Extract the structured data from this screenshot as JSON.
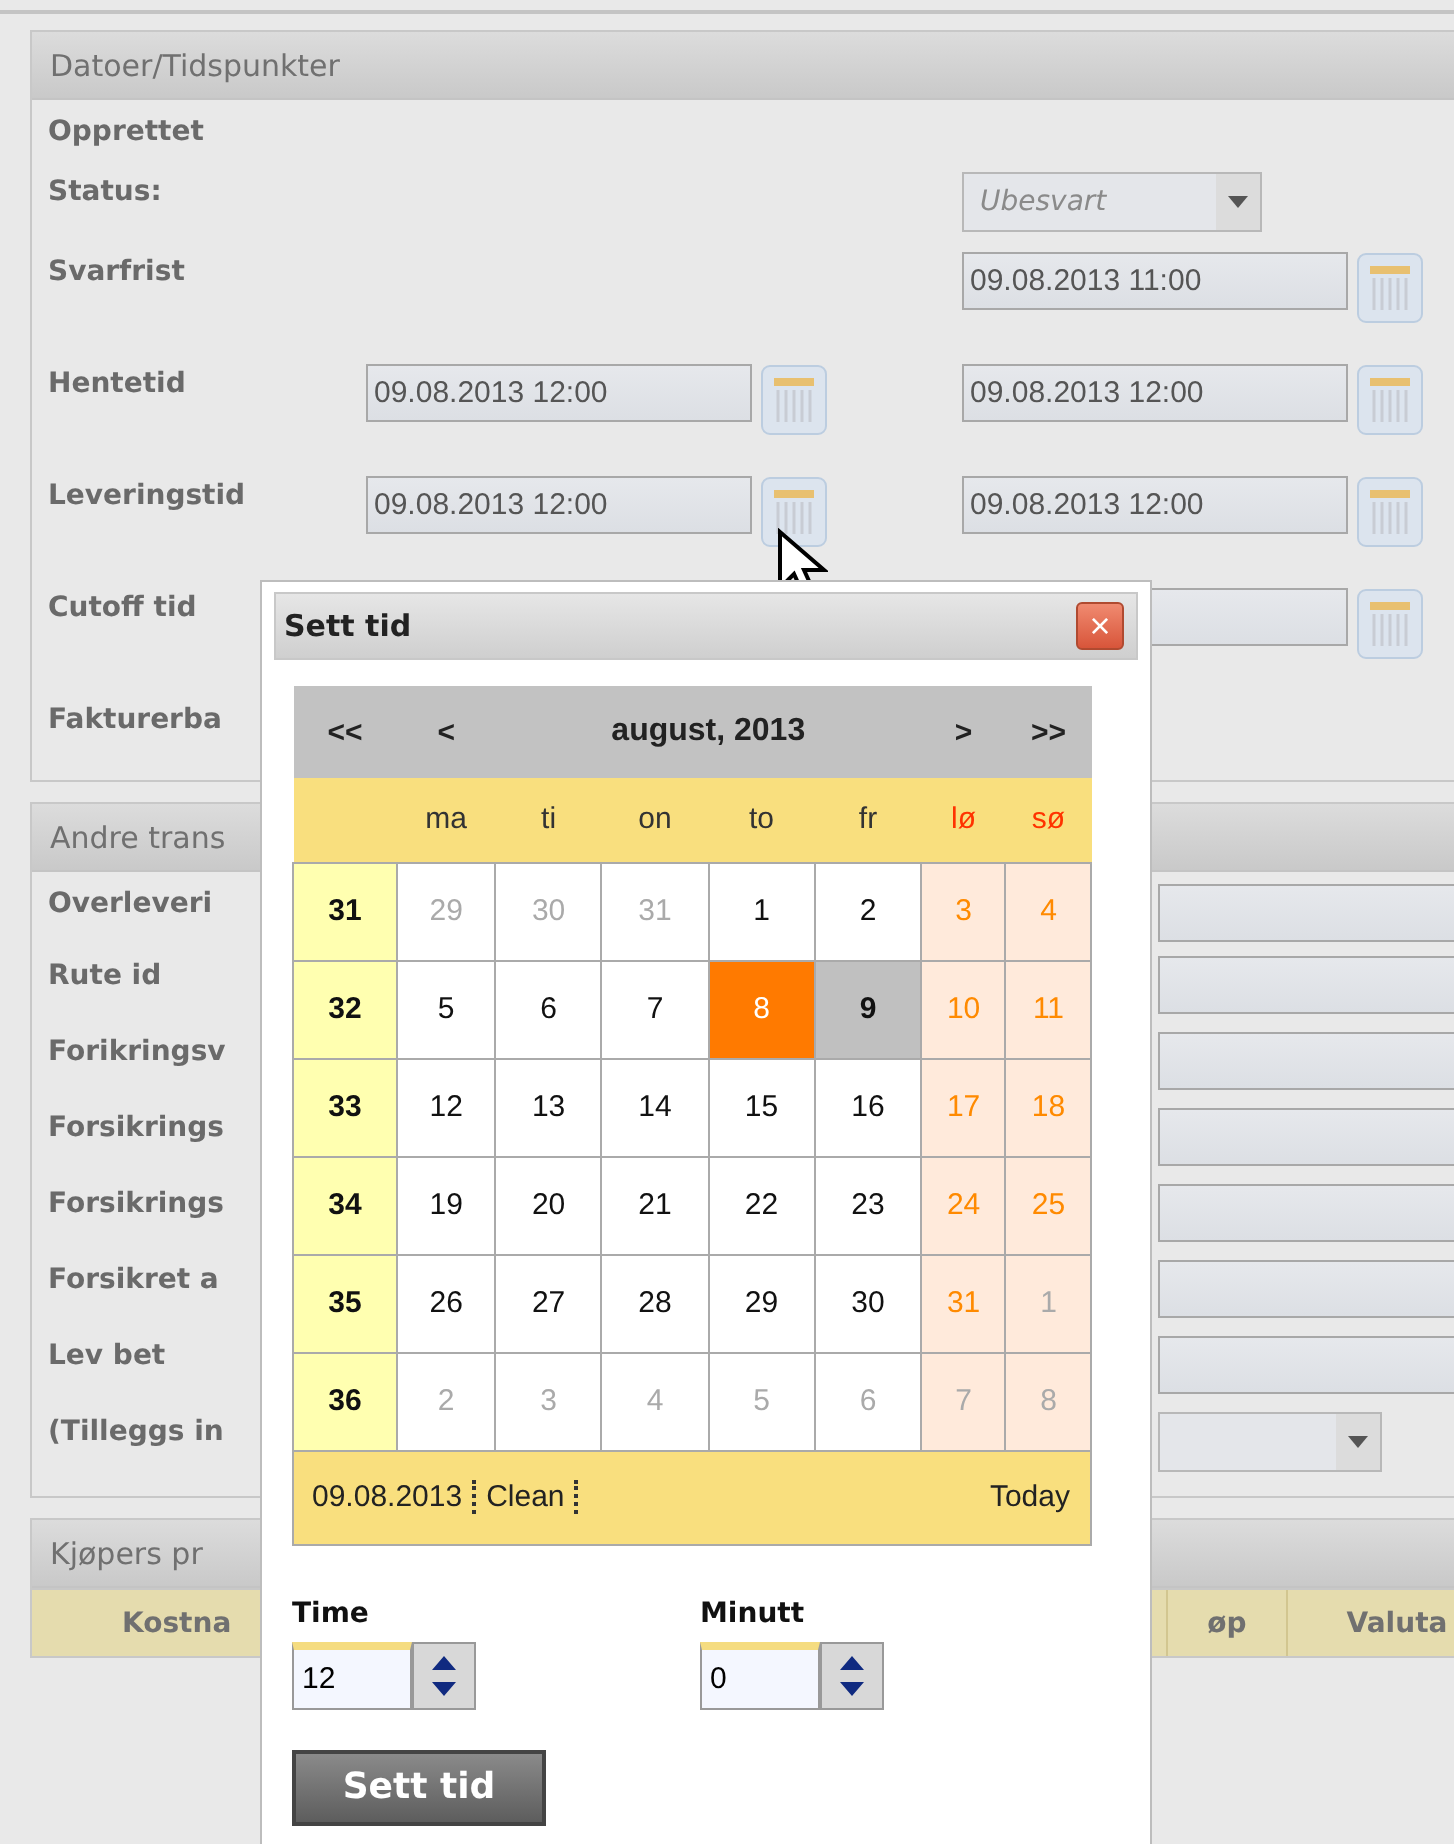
{
  "panels": [
    {
      "title": "Datoer/Tidspunkter",
      "rows": [
        {
          "kind": "plain",
          "label": "Opprettet"
        },
        {
          "kind": "select",
          "label": "Status:",
          "right": {
            "value": "Ubesvart"
          }
        },
        {
          "kind": "dates",
          "label": "Svarfrist",
          "right": {
            "value": "09.08.2013 11:00"
          }
        },
        {
          "kind": "dates",
          "label": "Hentetid",
          "left": {
            "value": "09.08.2013 12:00"
          },
          "right": {
            "value": "09.08.2013 12:00"
          }
        },
        {
          "kind": "dates",
          "label": "Leveringstid",
          "left": {
            "value": "09.08.2013 12:00"
          },
          "right": {
            "value": "09.08.2013 12:00"
          }
        },
        {
          "kind": "dates",
          "label": "Cutoff tid",
          "right": {}
        },
        {
          "kind": "plain",
          "label": "Fakturerba"
        }
      ]
    },
    {
      "title": "Andre trans",
      "rows": [
        {
          "kind": "field",
          "label": "Overleveri"
        },
        {
          "kind": "field",
          "label": "Rute id"
        },
        {
          "kind": "field",
          "label": "Forikringsv"
        },
        {
          "kind": "field",
          "label": "Forsikrings"
        },
        {
          "kind": "field",
          "label": "Forsikrings"
        },
        {
          "kind": "field",
          "label": "Forsikret a"
        },
        {
          "kind": "field",
          "label": "Lev bet"
        },
        {
          "kind": "select",
          "label": "(Tilleggs in"
        }
      ]
    },
    {
      "title": "Kjøpers pr",
      "columns": [
        "Kostna",
        "øp",
        "Valuta"
      ]
    }
  ],
  "dialog": {
    "title": "Sett tid",
    "close": "×",
    "calendar": {
      "nav_left": [
        "<<",
        "<"
      ],
      "title": "august, 2013",
      "nav_right": [
        ">",
        ">>"
      ],
      "weekdays": [
        {
          "label": "ma",
          "weekend": false
        },
        {
          "label": "ti",
          "weekend": false
        },
        {
          "label": "on",
          "weekend": false
        },
        {
          "label": "to",
          "weekend": false
        },
        {
          "label": "fr",
          "weekend": false
        },
        {
          "label": "lø",
          "weekend": true
        },
        {
          "label": "sø",
          "weekend": true
        }
      ],
      "weeks": [
        {
          "number": "31",
          "days": [
            {
              "label": "29",
              "other": true,
              "weekend": false,
              "selected": false,
              "today": false
            },
            {
              "label": "30",
              "other": true,
              "weekend": false,
              "selected": false,
              "today": false
            },
            {
              "label": "31",
              "other": true,
              "weekend": false,
              "selected": false,
              "today": false
            },
            {
              "label": "1",
              "other": false,
              "weekend": false,
              "selected": false,
              "today": false
            },
            {
              "label": "2",
              "other": false,
              "weekend": false,
              "selected": false,
              "today": false
            },
            {
              "label": "3",
              "other": false,
              "weekend": true,
              "selected": false,
              "today": false
            },
            {
              "label": "4",
              "other": false,
              "weekend": true,
              "selected": false,
              "today": false
            }
          ]
        },
        {
          "number": "32",
          "days": [
            {
              "label": "5",
              "other": false,
              "weekend": false,
              "selected": false,
              "today": false
            },
            {
              "label": "6",
              "other": false,
              "weekend": false,
              "selected": false,
              "today": false
            },
            {
              "label": "7",
              "other": false,
              "weekend": false,
              "selected": false,
              "today": false
            },
            {
              "label": "8",
              "other": false,
              "weekend": false,
              "selected": false,
              "today": true
            },
            {
              "label": "9",
              "other": false,
              "weekend": false,
              "selected": true,
              "today": false
            },
            {
              "label": "10",
              "other": false,
              "weekend": true,
              "selected": false,
              "today": false
            },
            {
              "label": "11",
              "other": false,
              "weekend": true,
              "selected": false,
              "today": false
            }
          ]
        },
        {
          "number": "33",
          "days": [
            {
              "label": "12",
              "other": false,
              "weekend": false,
              "selected": false,
              "today": false
            },
            {
              "label": "13",
              "other": false,
              "weekend": false,
              "selected": false,
              "today": false
            },
            {
              "label": "14",
              "other": false,
              "weekend": false,
              "selected": false,
              "today": false
            },
            {
              "label": "15",
              "other": false,
              "weekend": false,
              "selected": false,
              "today": false
            },
            {
              "label": "16",
              "other": false,
              "weekend": false,
              "selected": false,
              "today": false
            },
            {
              "label": "17",
              "other": false,
              "weekend": true,
              "selected": false,
              "today": false
            },
            {
              "label": "18",
              "other": false,
              "weekend": true,
              "selected": false,
              "today": false
            }
          ]
        },
        {
          "number": "34",
          "days": [
            {
              "label": "19",
              "other": false,
              "weekend": false,
              "selected": false,
              "today": false
            },
            {
              "label": "20",
              "other": false,
              "weekend": false,
              "selected": false,
              "today": false
            },
            {
              "label": "21",
              "other": false,
              "weekend": false,
              "selected": false,
              "today": false
            },
            {
              "label": "22",
              "other": false,
              "weekend": false,
              "selected": false,
              "today": false
            },
            {
              "label": "23",
              "other": false,
              "weekend": false,
              "selected": false,
              "today": false
            },
            {
              "label": "24",
              "other": false,
              "weekend": true,
              "selected": false,
              "today": false
            },
            {
              "label": "25",
              "other": false,
              "weekend": true,
              "selected": false,
              "today": false
            }
          ]
        },
        {
          "number": "35",
          "days": [
            {
              "label": "26",
              "other": false,
              "weekend": false,
              "selected": false,
              "today": false
            },
            {
              "label": "27",
              "other": false,
              "weekend": false,
              "selected": false,
              "today": false
            },
            {
              "label": "28",
              "other": false,
              "weekend": false,
              "selected": false,
              "today": false
            },
            {
              "label": "29",
              "other": false,
              "weekend": false,
              "selected": false,
              "today": false
            },
            {
              "label": "30",
              "other": false,
              "weekend": false,
              "selected": false,
              "today": false
            },
            {
              "label": "31",
              "other": false,
              "weekend": true,
              "selected": false,
              "today": false
            },
            {
              "label": "1",
              "other": true,
              "weekend": true,
              "selected": false,
              "today": false
            }
          ]
        },
        {
          "number": "36",
          "days": [
            {
              "label": "2",
              "other": true,
              "weekend": false,
              "selected": false,
              "today": false
            },
            {
              "label": "3",
              "other": true,
              "weekend": false,
              "selected": false,
              "today": false
            },
            {
              "label": "4",
              "other": true,
              "weekend": false,
              "selected": false,
              "today": false
            },
            {
              "label": "5",
              "other": true,
              "weekend": false,
              "selected": false,
              "today": false
            },
            {
              "label": "6",
              "other": true,
              "weekend": false,
              "selected": false,
              "today": false
            },
            {
              "label": "7",
              "other": true,
              "weekend": true,
              "selected": false,
              "today": false
            },
            {
              "label": "8",
              "other": true,
              "weekend": true,
              "selected": false,
              "today": false
            }
          ]
        }
      ],
      "footer": {
        "date": "09.08.2013",
        "clean": "Clean",
        "today": "Today"
      }
    },
    "spinners": [
      {
        "label": "Time",
        "value": "12"
      },
      {
        "label": "Minutt",
        "value": "0"
      }
    ],
    "button": "Sett tid"
  }
}
